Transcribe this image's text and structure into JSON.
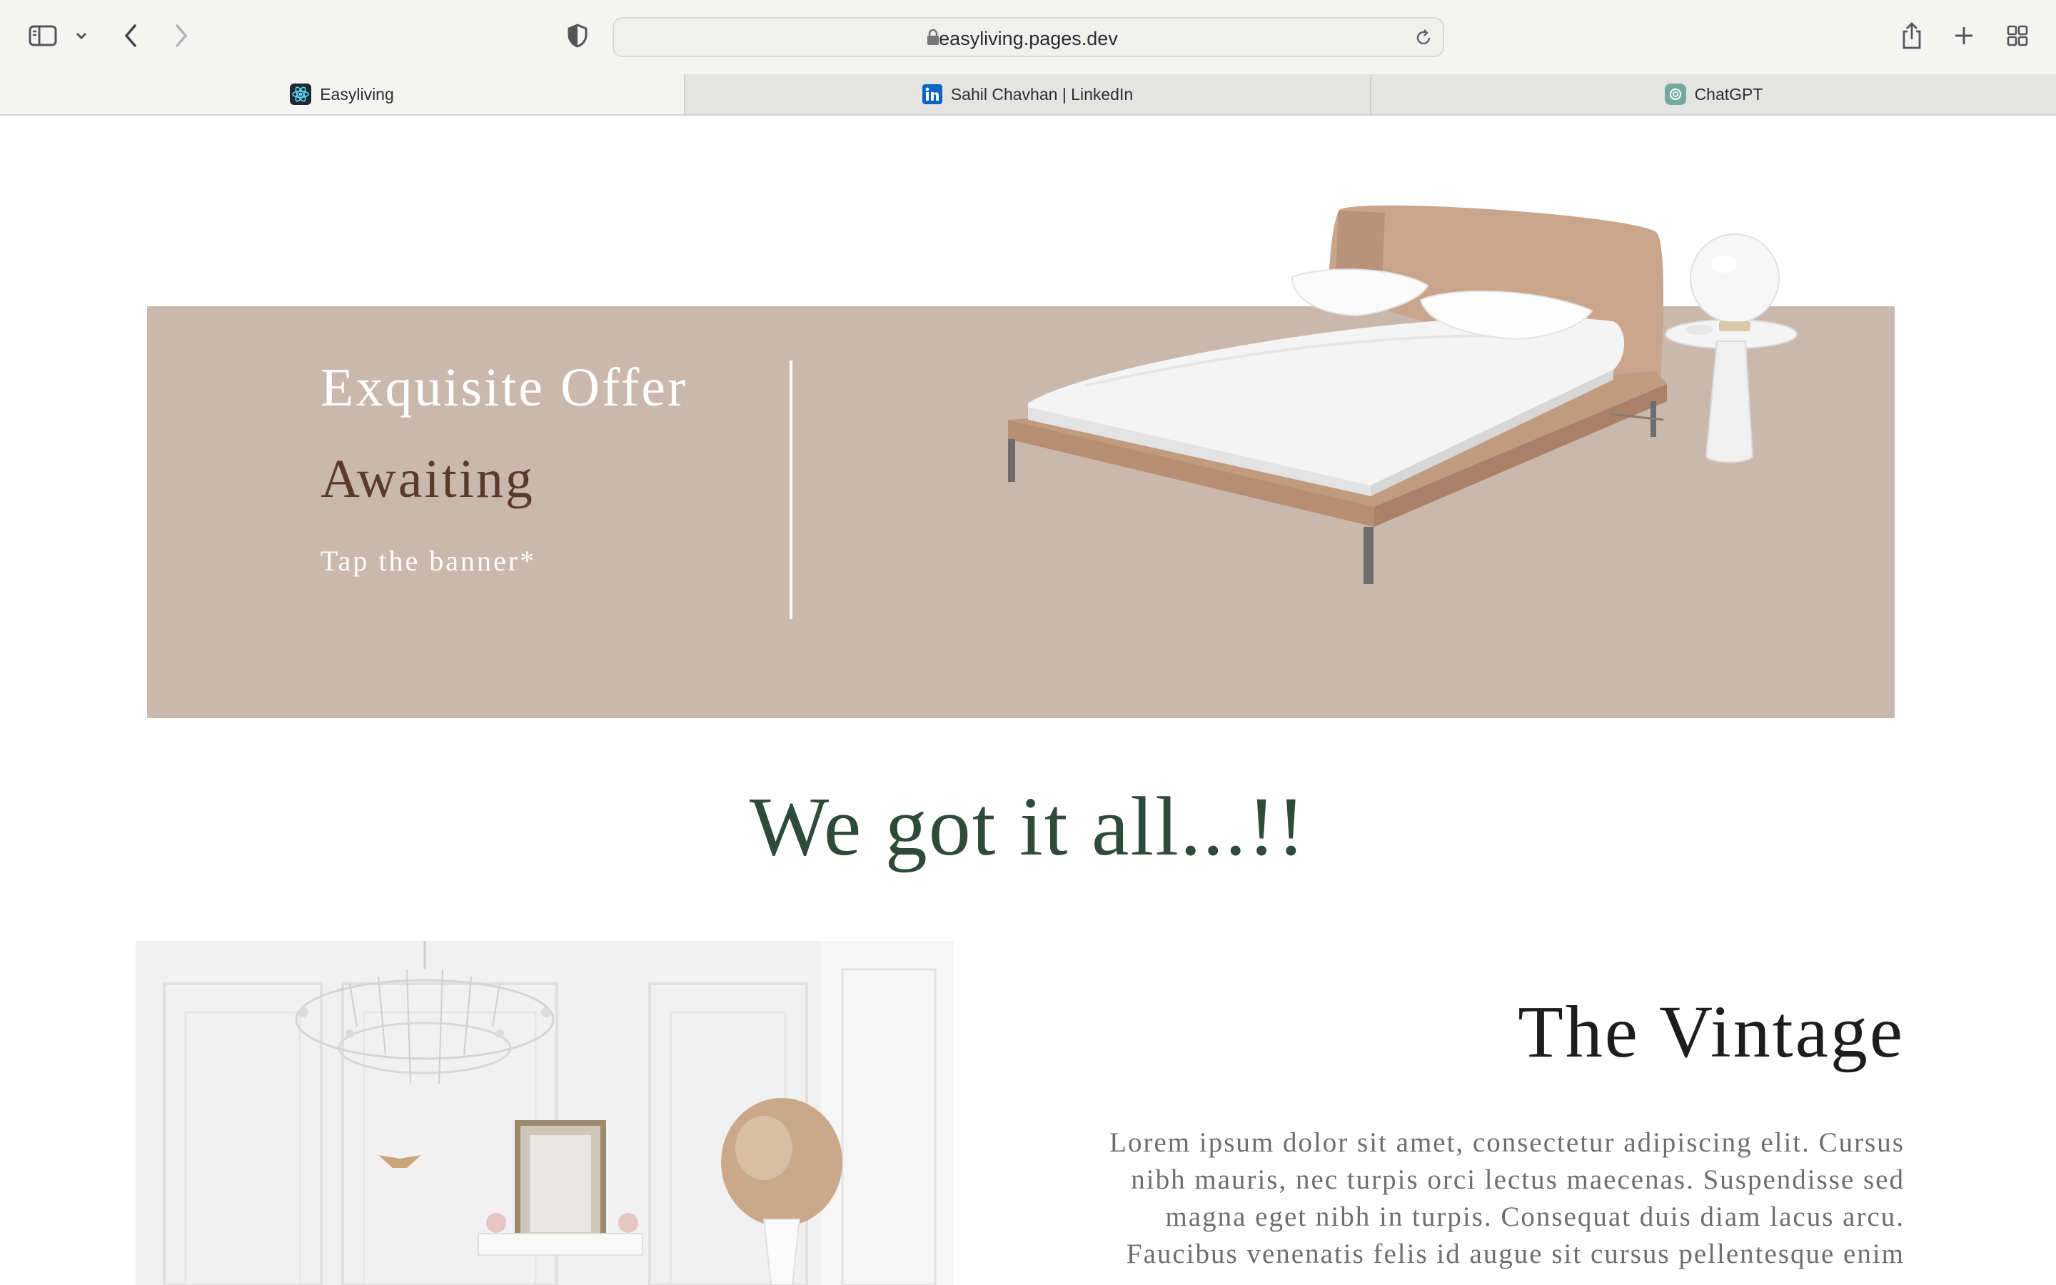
{
  "browser": {
    "url": "easyliving.pages.dev",
    "tabs": [
      {
        "label": "Easyliving",
        "active": true,
        "favicon": "react-icon"
      },
      {
        "label": "Sahil Chavhan | LinkedIn",
        "active": false,
        "favicon": "linkedin-icon"
      },
      {
        "label": "ChatGPT",
        "active": false,
        "favicon": "chatgpt-icon"
      }
    ],
    "colors": {
      "chrome": "#f4f4f3",
      "tabstrip": "#e4e4e3"
    }
  },
  "banner": {
    "line1": "Exquisite Offer",
    "line2": "Awaiting",
    "cta": "Tap the banner*",
    "image": "bed-with-side-table",
    "colors": {
      "background": "#cbb8ac",
      "accent_text": "#5a3a2a"
    }
  },
  "tagline": "We got it all...!!",
  "vintage": {
    "title": "The Vintage",
    "image": "white-vintage-room-with-chandelier",
    "body_lines": [
      "Lorem ipsum dolor sit amet, consectetur adipiscing elit. Cursus",
      "nibh mauris, nec turpis orci lectus maecenas. Suspendisse sed",
      "magna eget nibh in turpis. Consequat duis diam lacus arcu.",
      "Faucibus venenatis felis id augue sit cursus pellentesque enim"
    ]
  },
  "theme": {
    "heading_green": "#2d4a3a"
  }
}
